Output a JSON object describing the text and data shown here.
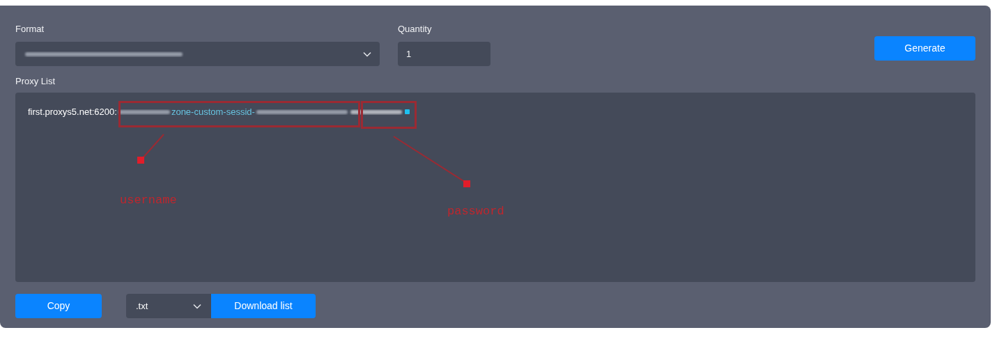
{
  "format": {
    "label": "Format"
  },
  "quantity": {
    "label": "Quantity",
    "value": "1"
  },
  "generate_button": "Generate",
  "proxy_list": {
    "label": "Proxy List",
    "line": {
      "host": "first.proxys5.net:6200:",
      "middle": "zone-custom-sessid-"
    }
  },
  "annotations": [
    {
      "text": "username"
    },
    {
      "text": "password"
    }
  ],
  "copy_button": "Copy",
  "extension": {
    "value": ".txt"
  },
  "download_button": "Download list"
}
